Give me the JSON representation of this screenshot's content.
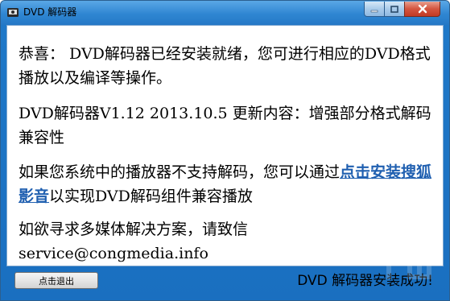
{
  "window": {
    "title": "DVD 解码器"
  },
  "content": {
    "para1": "恭喜： DVD解码器已经安装就绪，您可进行相应的DVD格式播放以及编译等操作。",
    "para2": "DVD解码器V1.12 2013.10.5 更新内容：增强部分格式解码兼容性",
    "para3_before": "如果您系统中的播放器不支持解码，您可以通过",
    "para3_link": "点击安装搜狐影音",
    "para3_after": "以实现DVD解码组件兼容播放",
    "para4_line1": "如欲寻求多媒体解决方案，请致信",
    "para4_email": "service@congmedia.info"
  },
  "footer": {
    "exit_label": "点击退出",
    "status_text": "DVD 解码器安装成功!"
  },
  "icons": {
    "app": "dvd-app-icon",
    "minimize": "minimize-icon",
    "maximize": "maximize-icon",
    "close": "close-icon"
  },
  "colors": {
    "frame": "#1f78c8",
    "link": "#1f5fb0",
    "close_button": "#d4553f"
  }
}
